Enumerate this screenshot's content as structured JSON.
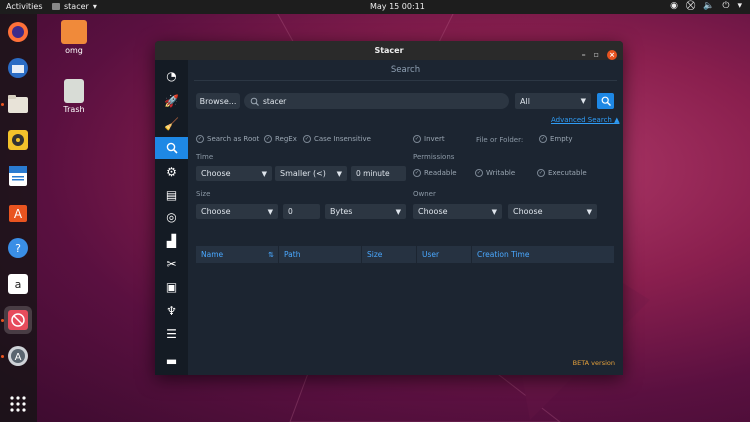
{
  "topbar": {
    "activities": "Activities",
    "app_name": "stacer",
    "clock": "May 15  00:11"
  },
  "desktop": {
    "icons": [
      {
        "label": "omg"
      },
      {
        "label": "Trash"
      }
    ]
  },
  "window": {
    "title": "Stacer",
    "page_title": "Search",
    "browse_label": "Browse...",
    "search_value": "stacer",
    "type_filter": "All",
    "advanced_link": "Advanced Search ▲",
    "options": {
      "search_as_root": "Search as Root",
      "regex": "RegEx",
      "case_insensitive": "Case Insensitive",
      "invert": "Invert",
      "file_or_folder": "File or Folder:",
      "empty": "Empty"
    },
    "time": {
      "label": "Time",
      "choose": "Choose",
      "comparator": "Smaller (<)",
      "value": "0 minute"
    },
    "permissions": {
      "label": "Permissions",
      "readable": "Readable",
      "writable": "Writable",
      "executable": "Executable"
    },
    "size": {
      "label": "Size",
      "choose": "Choose",
      "value": "0",
      "unit": "Bytes"
    },
    "owner": {
      "label": "Owner",
      "choose1": "Choose",
      "choose2": "Choose"
    },
    "table_headers": [
      "Name",
      "Path",
      "Size",
      "User",
      "Creation Time"
    ],
    "beta": "BETA version"
  },
  "colors": {
    "accent": "#1e88e5",
    "close": "#e95420",
    "window_bg": "#1c2531"
  }
}
